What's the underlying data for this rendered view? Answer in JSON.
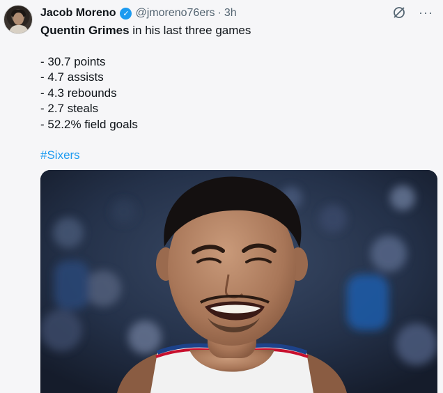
{
  "author": {
    "name": "Jacob Moreno",
    "handle": "@jmoreno76ers",
    "separator": "·",
    "time": "3h",
    "verified_icon": "check-badge-icon"
  },
  "top_icons": {
    "grok": "grok-icon",
    "more": "···"
  },
  "tweet": {
    "subject": "Quentin Grimes",
    "intro_rest": " in his last three games",
    "stats": [
      "- 30.7 points",
      "- 4.7 assists",
      "- 4.3 rebounds",
      "- 2.7 steals",
      "- 52.2% field goals"
    ],
    "hashtag": "#Sixers"
  },
  "media": {
    "kind": "photo",
    "jersey_colors": {
      "primary": "#f2f2f2",
      "trim_red": "#c8102e",
      "trim_blue": "#1d428a"
    }
  }
}
